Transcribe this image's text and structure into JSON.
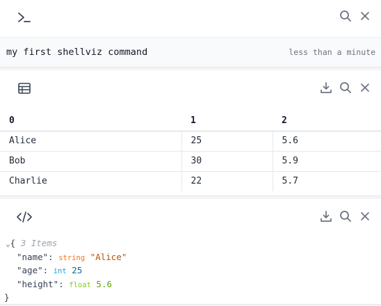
{
  "colors": {
    "accent": "#374151",
    "string_value": "#b45309",
    "int_value": "#0369a1",
    "float_value": "#65a30d"
  },
  "command_card": {
    "icon": "terminal-icon",
    "command": "my first shellviz command",
    "time": "less than a minute"
  },
  "table_card": {
    "icon": "table-icon",
    "columns": [
      "0",
      "1",
      "2"
    ],
    "rows": [
      [
        "Alice",
        "25",
        "5.6"
      ],
      [
        "Bob",
        "30",
        "5.9"
      ],
      [
        "Charlie",
        "22",
        "5.7"
      ]
    ]
  },
  "json_card": {
    "icon": "code-icon",
    "open_brace": "{",
    "close_brace": "}",
    "items_label": "3 Items",
    "entries": [
      {
        "key": "\"name\"",
        "type": "string",
        "value": "\"Alice\""
      },
      {
        "key": "\"age\"",
        "type": "int",
        "value": "25"
      },
      {
        "key": "\"height\"",
        "type": "float",
        "value": "5.6"
      }
    ]
  }
}
